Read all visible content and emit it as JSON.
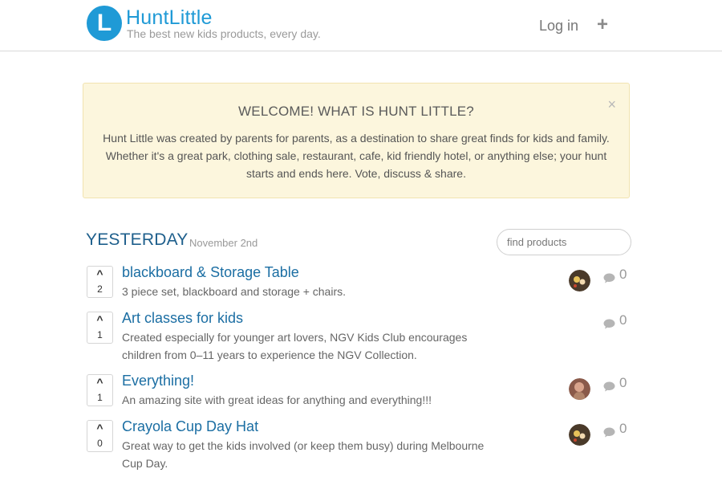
{
  "header": {
    "logo_letter": "L",
    "brand": "HuntLittle",
    "tagline": "The best new kids products, every day.",
    "login_label": "Log in",
    "add_label": "+"
  },
  "welcome": {
    "title": "WELCOME! WHAT IS HUNT LITTLE?",
    "close_label": "×",
    "body": "Hunt Little was created by parents for parents, as a destination to share great finds for kids and family. Whether it's a great park, clothing sale, restaurant, cafe, kid friendly hotel, or anything else; your hunt starts and ends here. Vote, discuss & share."
  },
  "section": {
    "title": "YESTERDAY",
    "date": "November 2nd",
    "search_placeholder": "find products"
  },
  "posts": [
    {
      "votes": "2",
      "title": "blackboard & Storage Table",
      "description": "3 piece set, blackboard and storage + chairs.",
      "has_avatar": true,
      "comments": "0"
    },
    {
      "votes": "1",
      "title": "Art classes for kids",
      "description": "Created especially for younger art lovers, NGV Kids Club encourages children from 0–11 years to experience the NGV Collection.",
      "has_avatar": false,
      "comments": "0"
    },
    {
      "votes": "1",
      "title": "Everything!",
      "description": "An amazing site with great ideas for anything and everything!!!",
      "has_avatar": true,
      "comments": "0"
    },
    {
      "votes": "0",
      "title": "Crayola Cup Day Hat",
      "description": "Great way to get the kids involved (or keep them busy) during Melbourne Cup Day.",
      "has_avatar": true,
      "comments": "0"
    }
  ],
  "colors": {
    "brand": "#1f9ad6",
    "link": "#1b6ea3",
    "section_title": "#1e5f8c",
    "alert_bg": "#fcf6dd"
  },
  "icons": {
    "upvote": "chevron-up-icon",
    "comment": "speech-bubble-icon",
    "close": "close-icon",
    "add": "plus-icon"
  }
}
